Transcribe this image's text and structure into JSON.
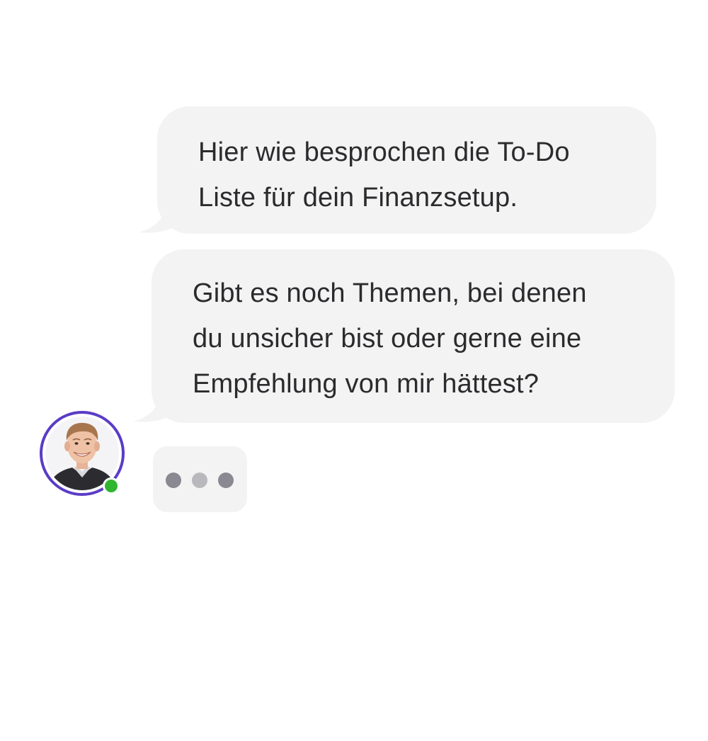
{
  "chat": {
    "messages": [
      {
        "text": "Hier wie besprochen die To-Do\nListe für dein Finanzsetup."
      },
      {
        "text": "Gibt es noch Themen, bei denen\ndu unsicher bist oder gerne eine\nEmpfehlung von mir hättest?"
      }
    ],
    "avatar": {
      "icon": "person-photo",
      "ring_color": "#5a3cc7",
      "status": "online",
      "status_color": "#2fb52f"
    },
    "typing_indicator": {
      "dot_colors": [
        "#8a8890",
        "#b9b8bd",
        "#8a8890"
      ]
    },
    "bubble_color": "#f3f3f3"
  }
}
